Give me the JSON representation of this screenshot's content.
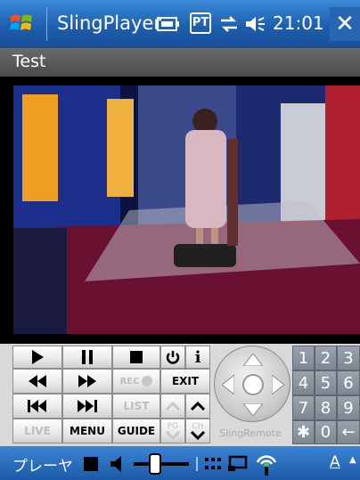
{
  "titlebar": {
    "app_title": "SlingPlayer",
    "pt_label": "PT",
    "time": "21:01",
    "close_label": "✕"
  },
  "subtitle": "Test",
  "controls": {
    "rec_label": "REC",
    "exit_label": "EXIT",
    "list_label": "LIST",
    "live_label": "LIVE",
    "menu_label": "MENU",
    "guide_label": "GUIDE",
    "pg_label": "PG",
    "ch_label": "CH",
    "info_label": "i",
    "slingremote_label": "SlingRemote",
    "numpad": [
      "1",
      "2",
      "3",
      "4",
      "5",
      "6",
      "7",
      "8",
      "9",
      "✱",
      "0",
      "←"
    ]
  },
  "bottombar": {
    "player_label": "プレーヤ",
    "input_label": "A"
  },
  "colors": {
    "titlebar_blue": "#1d5fae",
    "control_bg": "#d9d9d9",
    "numpad_gray": "#7c8792"
  }
}
